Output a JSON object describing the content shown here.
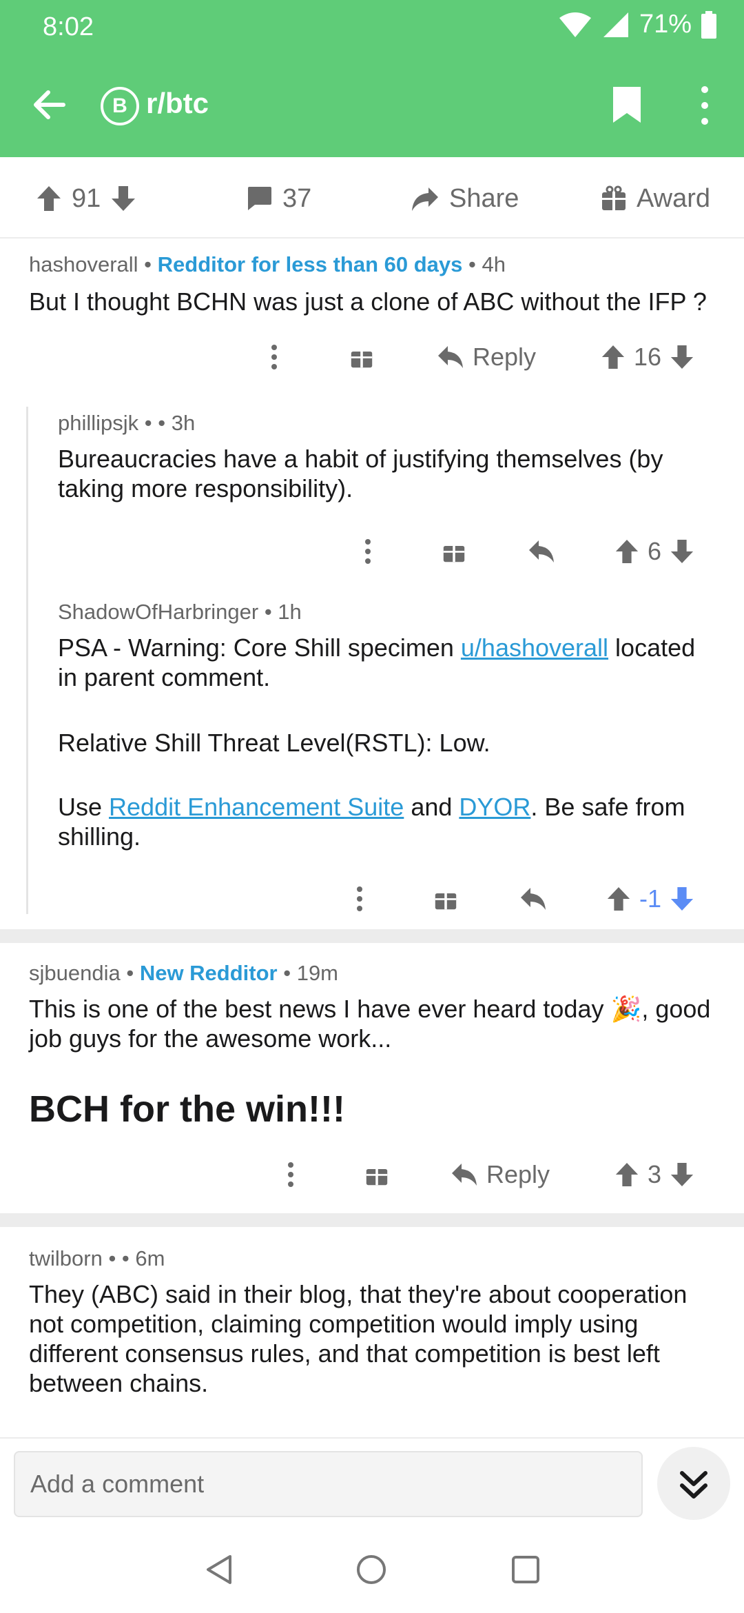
{
  "status": {
    "time": "8:02",
    "battery": "71%"
  },
  "app": {
    "subreddit": "r/btc",
    "sub_icon_letter": "B"
  },
  "post_actions": {
    "score": "91",
    "comments": "37",
    "share": "Share",
    "award": "Award"
  },
  "comments": [
    {
      "author": "hashoverall",
      "flair": "Redditor for less than 60 days",
      "time": "4h",
      "text": "But I thought  BCHN was just a clone of ABC without the IFP ?",
      "reply_label": "Reply",
      "score": "16"
    },
    {
      "author": "phillipsjk",
      "time": "3h",
      "text": "Bureaucracies have a habit of justifying themselves (by taking more responsibility).",
      "score": "6"
    },
    {
      "author": "ShadowOfHarbringer",
      "time": "1h",
      "text_1a": "PSA - Warning:  Core Shill specimen ",
      "link_user": "u/hashoverall",
      "text_1b": " located in parent comment.",
      "text_2": "Relative Shill Threat Level(RSTL): Low.",
      "text_3a": "Use ",
      "link_res": "Reddit Enhancement Suite",
      "text_3b": " and ",
      "link_dyor": "DYOR",
      "text_3c": ". Be safe from shilling.",
      "score": "-1"
    },
    {
      "author": "sjbuendia",
      "flair": "New Redditor",
      "time": "19m",
      "text_a": "This is one of the best news I have ever heard today",
      "text_b": ", good job guys for the awesome work...",
      "heading": "BCH for the win!!!",
      "reply_label": "Reply",
      "score": "3"
    },
    {
      "author": "twilborn",
      "time": "6m",
      "text": "They (ABC) said in their blog, that they're about cooperation not competition, claiming competition would imply using different consensus rules, and that competition is best left between chains."
    }
  ],
  "comment_input": {
    "placeholder": "Add a comment"
  },
  "colors": {
    "brand_green": "#5fcc78",
    "link_blue": "#2a9ad6",
    "downvote_blue": "#5b8cf5"
  }
}
